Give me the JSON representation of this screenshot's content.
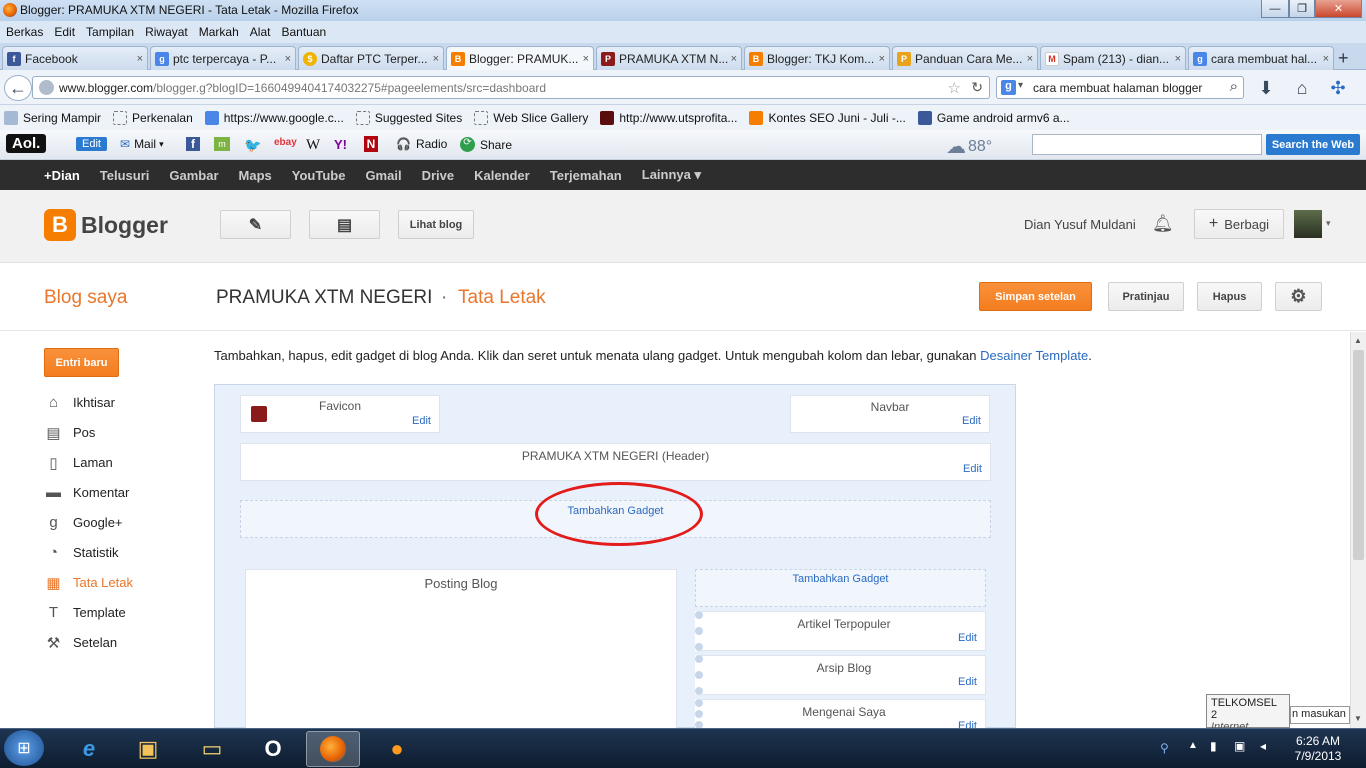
{
  "window": {
    "title": "Blogger: PRAMUKA XTM NEGERI - Tata Letak - Mozilla Firefox"
  },
  "menu": [
    "Berkas",
    "Edit",
    "Tampilan",
    "Riwayat",
    "Markah",
    "Alat",
    "Bantuan"
  ],
  "tabs": [
    {
      "label": "Facebook",
      "color": "#3b5998",
      "glyph": "f"
    },
    {
      "label": "ptc terpercaya - P...",
      "color": "#4a86e8",
      "glyph": "g"
    },
    {
      "label": "Daftar PTC Terper...",
      "color": "#f0b400",
      "glyph": "$"
    },
    {
      "label": "Blogger: PRAMUK...",
      "color": "#f57d00",
      "glyph": "B"
    },
    {
      "label": "PRAMUKA XTM N...",
      "color": "#8b1a1a",
      "glyph": "P"
    },
    {
      "label": "Blogger: TKJ Kom...",
      "color": "#f57d00",
      "glyph": "B"
    },
    {
      "label": "Panduan Cara Me...",
      "color": "#e8a21c",
      "glyph": "P"
    },
    {
      "label": "Spam (213) - dian...",
      "color": "#d93025",
      "glyph": "M"
    },
    {
      "label": "cara membuat hal...",
      "color": "#4a86e8",
      "glyph": "g"
    }
  ],
  "nav": {
    "url_domain": "www.blogger.com",
    "url_rest": "/blogger.g?blogID=1660499404174032275#pageelements/src=dashboard",
    "search_value": "cara membuat halaman blogger"
  },
  "bookmarks": [
    "Sering Mampir",
    "Perkenalan",
    "https://www.google.c...",
    "Suggested Sites",
    "Web Slice Gallery",
    "http://www.utsprofita...",
    "Kontes SEO Juni - Juli -...",
    "Game android armv6 a..."
  ],
  "aol": {
    "logo": "Aol.",
    "edit": "Edit",
    "mail": "Mail",
    "radio": "Radio",
    "share": "Share",
    "temp": "88°",
    "search_btn": "Search the Web"
  },
  "google_bar": [
    "+Dian",
    "Telusuri",
    "Gambar",
    "Maps",
    "YouTube",
    "Gmail",
    "Drive",
    "Kalender",
    "Terjemahan",
    "Lainnya ▾"
  ],
  "blogger": {
    "logo": "Blogger",
    "view_blog": "Lihat blog",
    "user": "Dian Yusuf Muldani",
    "share": "Berbagi",
    "my_blog": "Blog saya",
    "blog_name": "PRAMUKA XTM NEGERI",
    "sep": "·",
    "page": "Tata Letak",
    "save": "Simpan setelan",
    "preview": "Pratinjau",
    "delete": "Hapus",
    "new_post": "Entri baru"
  },
  "sidebar": [
    {
      "label": "Ikhtisar",
      "icon": "home-icon",
      "glyph": "⌂"
    },
    {
      "label": "Pos",
      "icon": "posts-icon",
      "glyph": "▤"
    },
    {
      "label": "Laman",
      "icon": "pages-icon",
      "glyph": "▯"
    },
    {
      "label": "Komentar",
      "icon": "comment-icon",
      "glyph": "▬"
    },
    {
      "label": "Google+",
      "icon": "googleplus-icon",
      "glyph": "g"
    },
    {
      "label": "Statistik",
      "icon": "stats-icon",
      "glyph": "◔"
    },
    {
      "label": "Tata Letak",
      "icon": "layout-icon",
      "glyph": "▦"
    },
    {
      "label": "Template",
      "icon": "template-icon",
      "glyph": "T"
    },
    {
      "label": "Setelan",
      "icon": "wrench-icon",
      "glyph": "⚒"
    }
  ],
  "layout": {
    "intro": "Tambahkan, hapus, edit gadget di blog Anda. Klik dan seret untuk menata ulang gadget. Untuk mengubah kolom dan lebar, gunakan",
    "intro_link": "Desainer Template",
    "intro_end": ".",
    "favicon": "Favicon",
    "navbar": "Navbar",
    "header": "PRAMUKA XTM NEGERI (Header)",
    "add_gadget": "Tambahkan Gadget",
    "posts": "Posting Blog",
    "side_add_gadget": "Tambahkan Gadget",
    "popular": "Artikel Terpopuler",
    "archive": "Arsip Blog",
    "about": "Mengenai Saya",
    "edit": "Edit"
  },
  "tooltip": {
    "line1": "TELKOMSEL  2",
    "line2": "Internet access",
    "behind": "n masukan"
  },
  "clock": {
    "time": "6:26 AM",
    "date": "7/9/2013"
  }
}
